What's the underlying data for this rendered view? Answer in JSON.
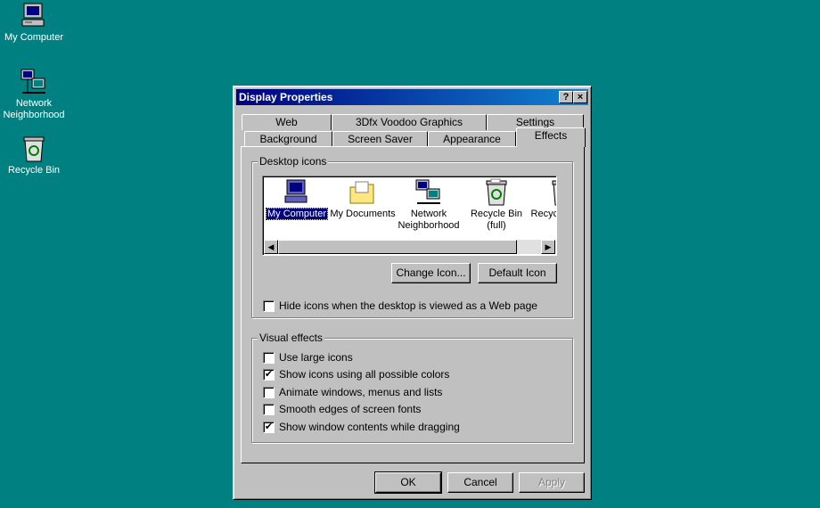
{
  "desktop": {
    "icons": [
      {
        "label": "My Computer"
      },
      {
        "label": "Network Neighborhood"
      },
      {
        "label": "Recycle Bin"
      }
    ]
  },
  "dialog": {
    "title": "Display Properties",
    "help_button": "?",
    "close_button": "×",
    "tabs_row1": [
      "Web",
      "3Dfx Voodoo Graphics",
      "Settings"
    ],
    "tabs_row2": [
      "Background",
      "Screen Saver",
      "Appearance",
      "Effects"
    ],
    "active_tab": "Effects",
    "desktop_icons": {
      "label": "Desktop icons",
      "items": [
        {
          "label": "My Computer",
          "selected": true
        },
        {
          "label": "My Documents",
          "selected": false
        },
        {
          "label": "Network Neighborhood",
          "selected": false
        },
        {
          "label": "Recycle Bin (full)",
          "selected": false
        },
        {
          "label": "Recycle Bin (e",
          "selected": false
        }
      ],
      "change_icon_button": "Change Icon...",
      "default_icon_button": "Default Icon",
      "hide_icons_option": {
        "label": "Hide icons when the desktop is viewed as a Web page",
        "checked": false
      }
    },
    "visual_effects": {
      "label": "Visual effects",
      "options": [
        {
          "label": "Use large icons",
          "checked": false
        },
        {
          "label": "Show icons using all possible colors",
          "checked": true
        },
        {
          "label": "Animate windows, menus and lists",
          "checked": false
        },
        {
          "label": "Smooth edges of screen fonts",
          "checked": false
        },
        {
          "label": "Show window contents while dragging",
          "checked": true
        }
      ]
    },
    "buttons": {
      "ok": "OK",
      "cancel": "Cancel",
      "apply": "Apply"
    }
  }
}
